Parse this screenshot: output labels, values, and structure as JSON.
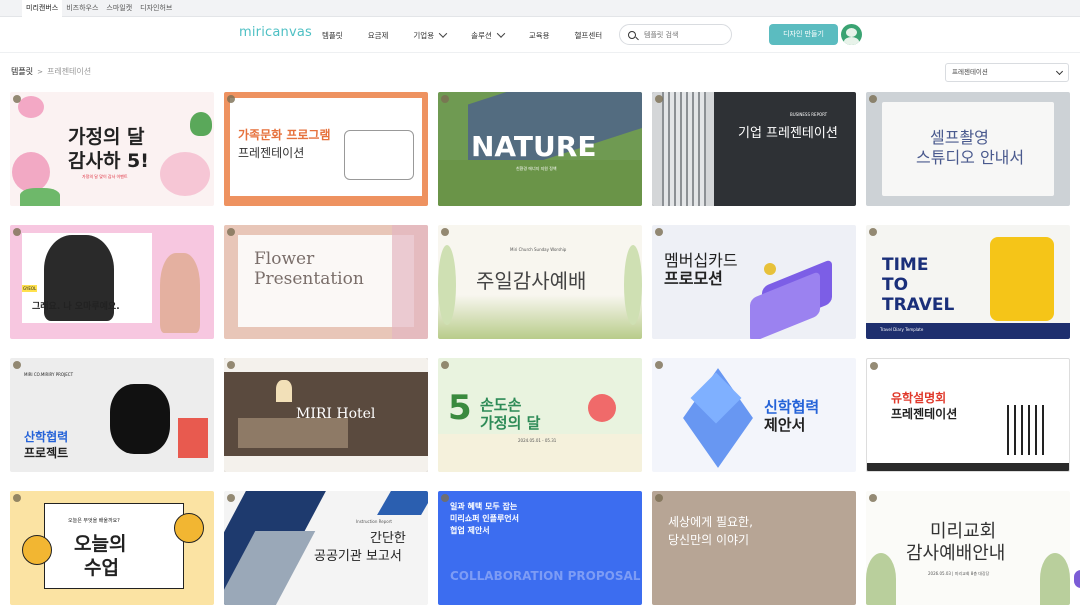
{
  "topbar": {
    "tabs": [
      "미리캔버스",
      "비즈하우스",
      "스마일캣",
      "디자인허브"
    ],
    "active": 0
  },
  "header": {
    "logo": "miricanvas",
    "nav": [
      {
        "label": "템플릿",
        "dropdown": false
      },
      {
        "label": "요금제",
        "dropdown": false
      },
      {
        "label": "기업용",
        "dropdown": true
      },
      {
        "label": "솔루션",
        "dropdown": true
      },
      {
        "label": "교육용",
        "dropdown": false
      },
      {
        "label": "헬프센터",
        "dropdown": false
      }
    ],
    "search_placeholder": "템플릿 검색",
    "design_button": "디자인 만들기"
  },
  "breadcrumb": {
    "root": "템플릿",
    "separator": ">",
    "current": "프레젠테이션"
  },
  "filter_select": {
    "value": "프레젠테이션"
  },
  "cards": [
    {
      "id": "c1",
      "t1": "가정의 달",
      "t2": "감사하 5!",
      "sub": "가정의 달 맞이 감사 이벤트",
      "bg": "#fbf3f3",
      "fg": "#2a2a2a"
    },
    {
      "id": "c2",
      "t1": "가족문화 프로그램",
      "t2": "프레젠테이션",
      "bg": "#f0a070",
      "fg": "#333"
    },
    {
      "id": "c3",
      "t1": "NATURE",
      "sub": "친환경 에너지 지원 정책",
      "bg": "#6f9a52",
      "fg": "#ffffff"
    },
    {
      "id": "c4",
      "t1": "BUSINESS REPORT",
      "t2": "기업 프레젠테이션",
      "bg": "#2f3236",
      "fg": "#ffffff"
    },
    {
      "id": "c5",
      "t1": "셀프촬영",
      "t2": "스튜디오 안내서",
      "bg": "#cfd4d8",
      "fg": "#4c5a8a"
    },
    {
      "id": "c6",
      "t1": "그래요. 나 오마루예요.",
      "t2": "GYEOL",
      "bg": "#f6c8e2",
      "fg": "#222"
    },
    {
      "id": "c7",
      "t1": "Flower",
      "t2": "Presentation",
      "bg": "#e9c8bb",
      "fg": "#7a6f6a"
    },
    {
      "id": "c8",
      "t1": "Miri Church Sunday Worship",
      "t2": "주일감사예배",
      "bg": "#f8f6ef",
      "fg": "#444"
    },
    {
      "id": "c9",
      "t1": "멤버십카드",
      "t2": "프로모션",
      "bg": "#eef0f6",
      "fg": "#222"
    },
    {
      "id": "c10",
      "t1": "TIME",
      "t2": "TO",
      "t3": "TRAVEL",
      "sub": "Travel Diary Template",
      "bg": "#f5f5f2",
      "fg": "#1a2f7a"
    },
    {
      "id": "c11",
      "t1": "MIRI CO.MIRIRY PROJECT",
      "t2": "산학협력",
      "t3": "프로젝트",
      "bg": "#eeeeee",
      "fg": "#2563d8"
    },
    {
      "id": "c12",
      "t1": "MIRI Hotel",
      "bg": "#5a4a3e",
      "fg": "#ffffff"
    },
    {
      "id": "c13",
      "t1": "5",
      "t2": "손도손",
      "t3": "가정의 달",
      "sub": "2024.05.01 - 05.31",
      "bg": "#eaf3e2",
      "fg": "#2e8b57"
    },
    {
      "id": "c14",
      "t1": "신학협력",
      "t2": "제안서",
      "bg": "#f3f5fb",
      "fg": "#2563d8"
    },
    {
      "id": "c15",
      "t1": "유학설명회",
      "t2": "프레젠테이션",
      "bg": "#ffffff",
      "fg": "#222"
    },
    {
      "id": "c16",
      "t1": "오늘은 무엇을 배울까요?",
      "t2": "오늘의",
      "t3": "수업",
      "bg": "#fbe6a8",
      "fg": "#222"
    },
    {
      "id": "c17",
      "t1": "Instruction Report",
      "t2": "간단한",
      "t3": "공공기관 보고서",
      "bg": "#f4f4f4",
      "fg": "#222"
    },
    {
      "id": "c18",
      "t1": "일과 혜택 모두 잡는",
      "t2": "미리쇼퍼 인플루언서",
      "t3": "협업 제안서",
      "sub": "COLLABORATION PROPOSAL",
      "bg": "#3c6df0",
      "fg": "#ffffff"
    },
    {
      "id": "c19",
      "t1": "세상에게 필요한,",
      "t2": "당신만의 이야기",
      "bg": "#b7a596",
      "fg": "#ffffff"
    },
    {
      "id": "c20",
      "t1": "미리교회",
      "t2": "감사예배안내",
      "sub": "2026.05.03 | 미리교회 8층 대강당",
      "bg": "#fbfbf8",
      "fg": "#333"
    }
  ],
  "colors": {
    "accent": "#5bbcc0",
    "logo": "#4fc0c4"
  }
}
